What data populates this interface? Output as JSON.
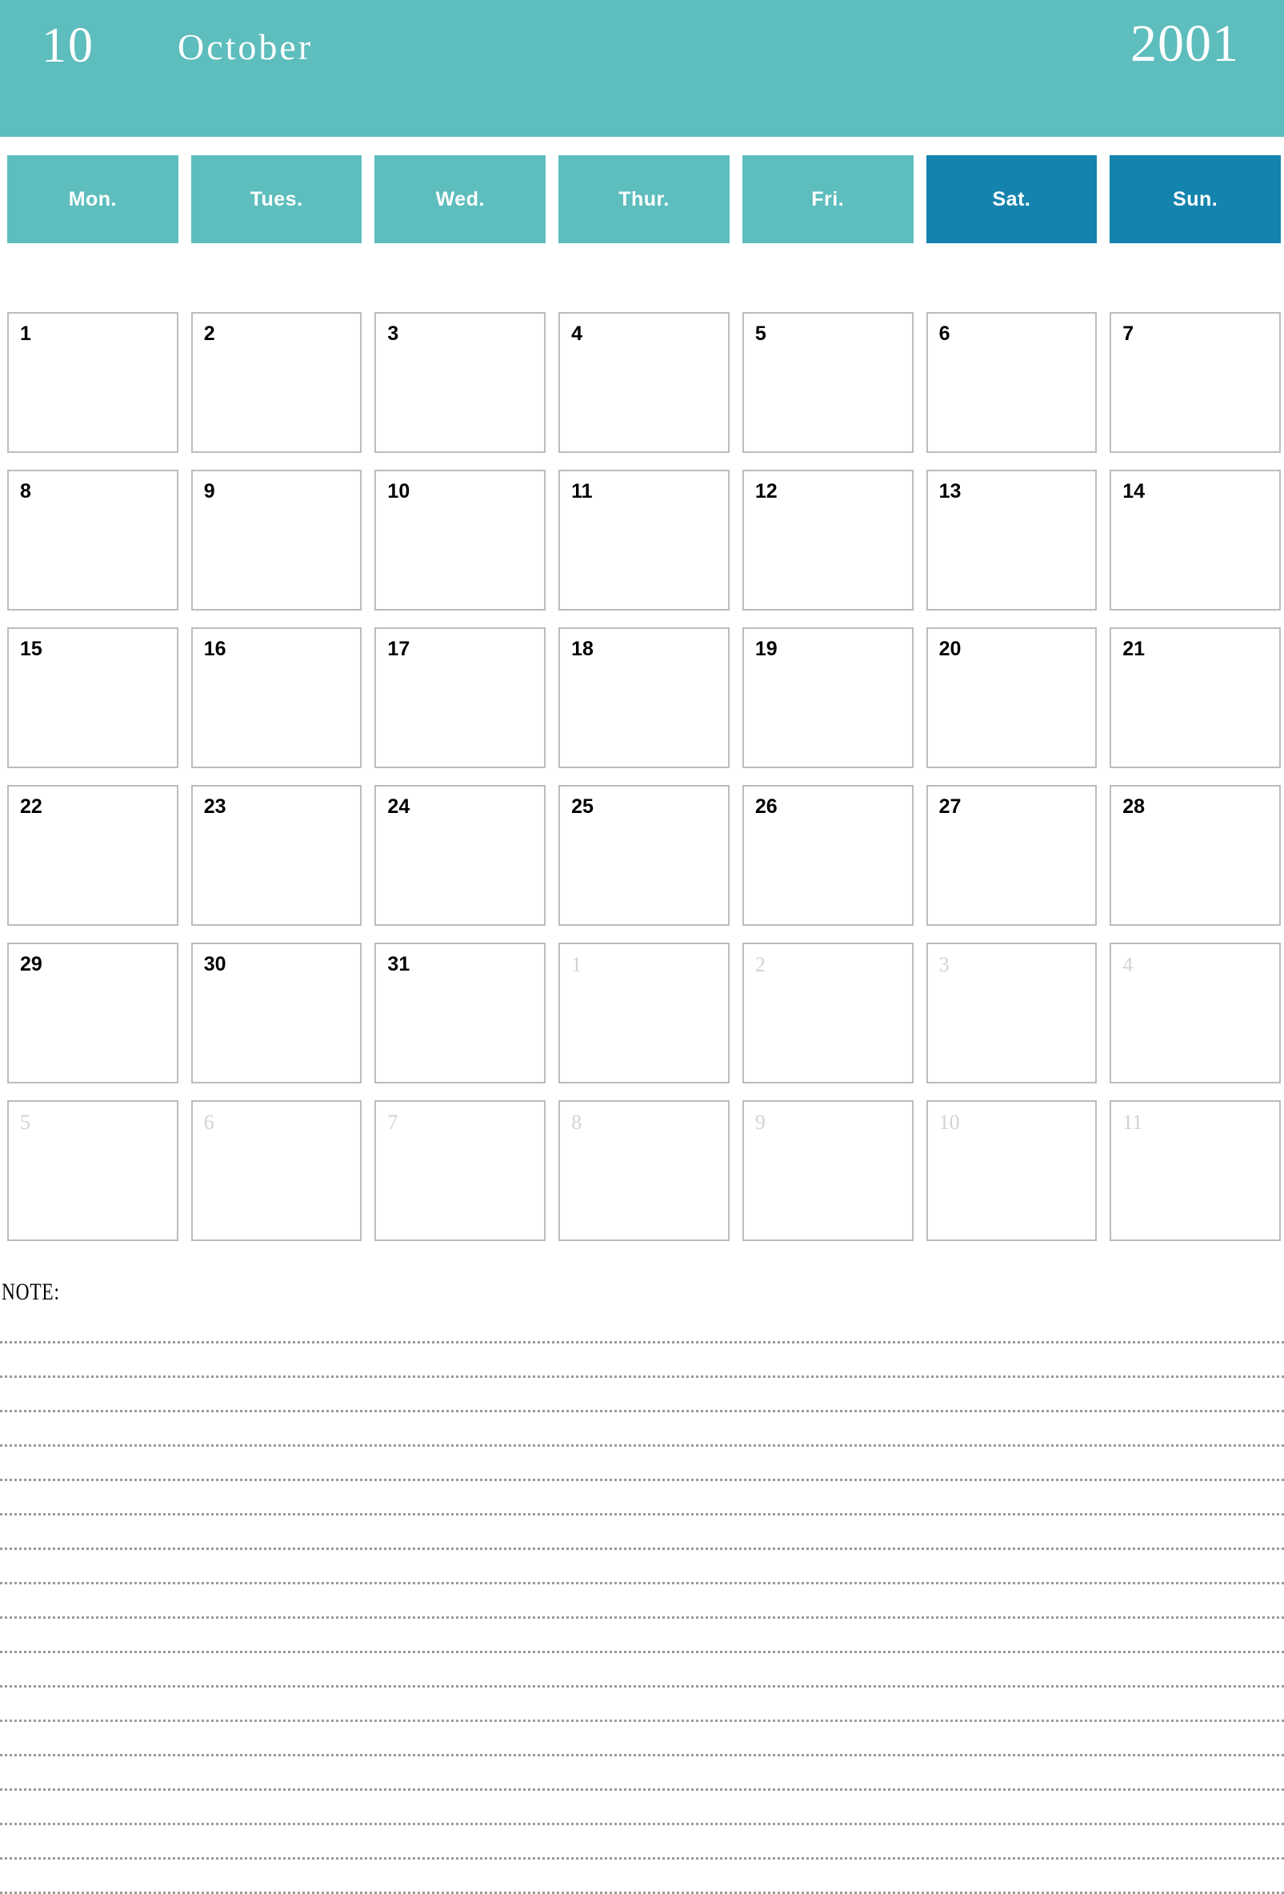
{
  "header": {
    "month_number": "10",
    "month_name": "October",
    "year": "2001",
    "background_color": "#5ebdbd",
    "text_color": "#ffffff"
  },
  "weekdays": [
    {
      "label": "Mon.",
      "weekend": false
    },
    {
      "label": "Tues.",
      "weekend": false
    },
    {
      "label": "Wed.",
      "weekend": false
    },
    {
      "label": "Thur.",
      "weekend": false
    },
    {
      "label": "Fri.",
      "weekend": false
    },
    {
      "label": "Sat.",
      "weekend": true
    },
    {
      "label": "Sun.",
      "weekend": true
    }
  ],
  "colors": {
    "weekday_teal": "#5ebdbd",
    "weekend_blue": "#1483ad",
    "cell_border": "#bcbcbc",
    "current_month_text": "#000000",
    "other_month_text": "#d3d3d3",
    "note_rule": "#9a9a9a"
  },
  "grid": {
    "rows": 6,
    "columns": 7,
    "days": [
      {
        "label": "1",
        "current_month": true
      },
      {
        "label": "2",
        "current_month": true
      },
      {
        "label": "3",
        "current_month": true
      },
      {
        "label": "4",
        "current_month": true
      },
      {
        "label": "5",
        "current_month": true
      },
      {
        "label": "6",
        "current_month": true
      },
      {
        "label": "7",
        "current_month": true
      },
      {
        "label": "8",
        "current_month": true
      },
      {
        "label": "9",
        "current_month": true
      },
      {
        "label": "10",
        "current_month": true
      },
      {
        "label": "11",
        "current_month": true
      },
      {
        "label": "12",
        "current_month": true
      },
      {
        "label": "13",
        "current_month": true
      },
      {
        "label": "14",
        "current_month": true
      },
      {
        "label": "15",
        "current_month": true
      },
      {
        "label": "16",
        "current_month": true
      },
      {
        "label": "17",
        "current_month": true
      },
      {
        "label": "18",
        "current_month": true
      },
      {
        "label": "19",
        "current_month": true
      },
      {
        "label": "20",
        "current_month": true
      },
      {
        "label": "21",
        "current_month": true
      },
      {
        "label": "22",
        "current_month": true
      },
      {
        "label": "23",
        "current_month": true
      },
      {
        "label": "24",
        "current_month": true
      },
      {
        "label": "25",
        "current_month": true
      },
      {
        "label": "26",
        "current_month": true
      },
      {
        "label": "27",
        "current_month": true
      },
      {
        "label": "28",
        "current_month": true
      },
      {
        "label": "29",
        "current_month": true
      },
      {
        "label": "30",
        "current_month": true
      },
      {
        "label": "31",
        "current_month": true
      },
      {
        "label": "1",
        "current_month": false
      },
      {
        "label": "2",
        "current_month": false
      },
      {
        "label": "3",
        "current_month": false
      },
      {
        "label": "4",
        "current_month": false
      },
      {
        "label": "5",
        "current_month": false
      },
      {
        "label": "6",
        "current_month": false
      },
      {
        "label": "7",
        "current_month": false
      },
      {
        "label": "8",
        "current_month": false
      },
      {
        "label": "9",
        "current_month": false
      },
      {
        "label": "10",
        "current_month": false
      },
      {
        "label": "11",
        "current_month": false
      }
    ]
  },
  "note": {
    "label": "NOTE:",
    "line_count": 17
  }
}
